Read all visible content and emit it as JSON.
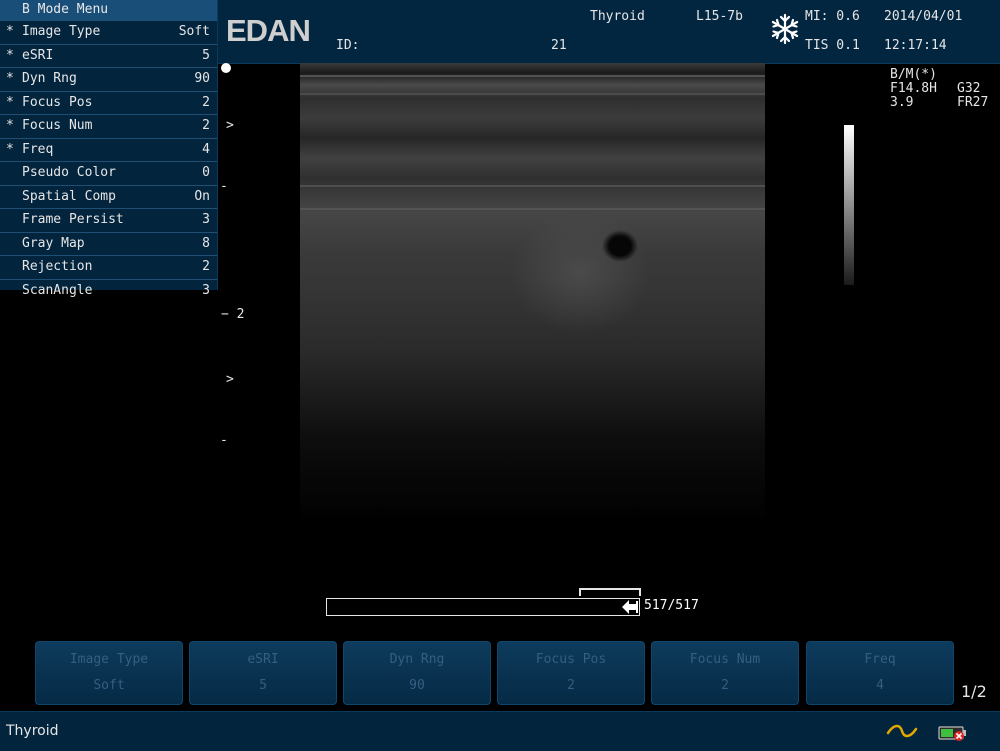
{
  "menu": {
    "title": "B Mode Menu",
    "items": [
      {
        "star": "*",
        "label": "Image Type",
        "value": "Soft"
      },
      {
        "star": "*",
        "label": "eSRI",
        "value": "5"
      },
      {
        "star": "*",
        "label": "Dyn Rng",
        "value": "90"
      },
      {
        "star": "*",
        "label": "Focus Pos",
        "value": "2"
      },
      {
        "star": "*",
        "label": "Focus Num",
        "value": "2"
      },
      {
        "star": "*",
        "label": "Freq",
        "value": "4"
      },
      {
        "star": "",
        "label": "Pseudo Color",
        "value": "0"
      },
      {
        "star": "",
        "label": "Spatial Comp",
        "value": "On"
      },
      {
        "star": "",
        "label": "Frame Persist",
        "value": "3"
      },
      {
        "star": "",
        "label": "Gray Map",
        "value": "8"
      },
      {
        "star": "",
        "label": "Rejection",
        "value": "2"
      },
      {
        "star": "",
        "label": "ScanAngle",
        "value": "3"
      }
    ]
  },
  "header": {
    "logo": "EDAN",
    "id_label": "ID:",
    "exam": "Thyroid",
    "exam_number": "21",
    "probe": "L15-7b",
    "mi": "MI: 0.6",
    "tis": "TIS 0.1",
    "date": "2014/04/01",
    "time": "12:17:14"
  },
  "depth": {
    "marker_top": ">",
    "tick1": "-",
    "label_2": "− 2",
    "marker_bottom": ">",
    "tick2": "-"
  },
  "params": {
    "mode": "B/M(*)",
    "freq": "F14.8H",
    "gain": "G32",
    "depth": "3.9",
    "framerate": "FR27"
  },
  "cine": {
    "count": "517/517",
    "fill_fraction": 1.0
  },
  "softkeys": [
    {
      "label": "Image Type",
      "value": "Soft"
    },
    {
      "label": "eSRI",
      "value": "5"
    },
    {
      "label": "Dyn Rng",
      "value": "90"
    },
    {
      "label": "Focus Pos",
      "value": "2"
    },
    {
      "label": "Focus Num",
      "value": "2"
    },
    {
      "label": "Freq",
      "value": "4"
    }
  ],
  "page_indicator": "1/2",
  "footer": {
    "status": "Thyroid"
  },
  "icons": {
    "freeze": "snowflake-icon",
    "ac": "ac-power-icon",
    "battery": "battery-icon"
  }
}
